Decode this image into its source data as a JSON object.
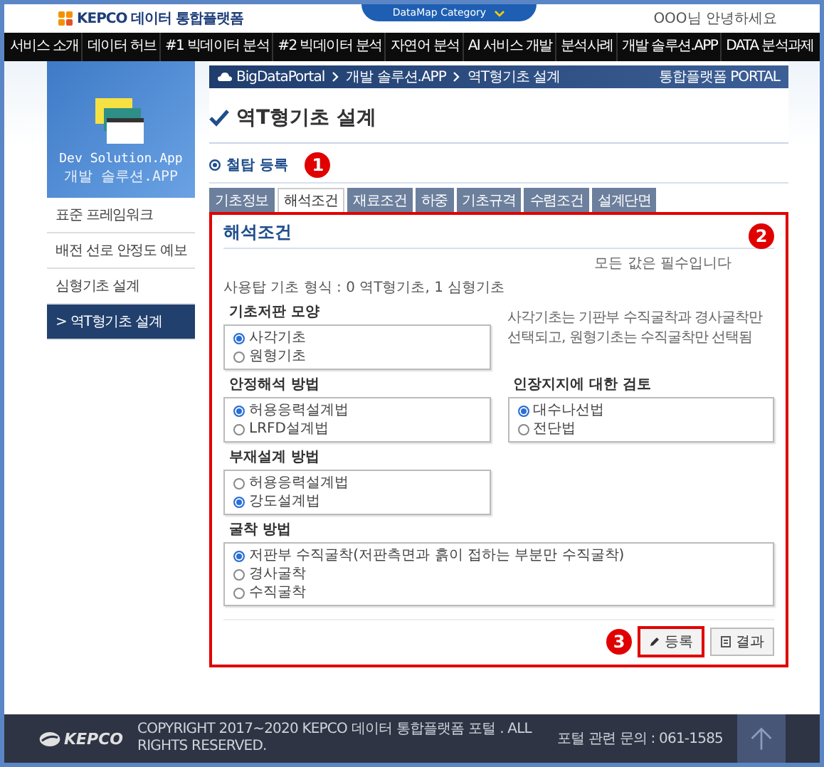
{
  "header": {
    "logo_text": "KEPCO 데이터 통합플랫폼",
    "category_tab": "DataMap Category",
    "greeting": "OOO님 안녕하세요"
  },
  "nav": [
    "서비스 소개",
    "데이터 허브",
    "#1 빅데이터 분석",
    "#2 빅데이터 분석",
    "자연어 분석",
    "AI 서비스 개발",
    "분석사례",
    "개발 솔루션.APP",
    "DATA 분석과제"
  ],
  "sidebar": {
    "banner_title": "Dev Solution.App",
    "banner_subtitle": "개발 솔루션.APP",
    "items": [
      {
        "label": "표준 프레임워크",
        "selected": false
      },
      {
        "label": "배전 선로 안정도 예보",
        "selected": false
      },
      {
        "label": "심형기초 설계",
        "selected": false
      },
      {
        "label": "> 역T형기초 설계",
        "selected": true
      }
    ]
  },
  "breadcrumb": {
    "items": [
      "BigDataPortal",
      "개발 솔루션.APP",
      "역T형기초 설계"
    ],
    "portal_label": "통합플랫폼 PORTAL"
  },
  "page_title": "역T형기초 설계",
  "section": {
    "title": "철탑 등록",
    "callout": "1"
  },
  "tabs": [
    {
      "label": "기초정보",
      "selected": false
    },
    {
      "label": "해석조건",
      "selected": true
    },
    {
      "label": "재료조건",
      "selected": false
    },
    {
      "label": "하중",
      "selected": false
    },
    {
      "label": "기초규격",
      "selected": false
    },
    {
      "label": "수렴조건",
      "selected": false
    },
    {
      "label": "설계단면",
      "selected": false
    }
  ],
  "panel": {
    "title": "해석조건",
    "highlighted": true,
    "callout": "2",
    "required_note": "모든 값은 필수입니다",
    "note": "사용탑 기초 형식 : 0 역T형기초, 1 심형기초",
    "rows": [
      {
        "kind": "split",
        "items": [
          {
            "kind": "group",
            "title": "기초저판 모양",
            "options": [
              {
                "label": "사각기초",
                "selected": true
              },
              {
                "label": "원형기초",
                "selected": false
              }
            ]
          },
          {
            "kind": "hint",
            "text": "사각기초는 기판부 수직굴착과 경사굴착만 선택되고, 원형기초는 수직굴착만 선택됨"
          }
        ]
      },
      {
        "kind": "split",
        "items": [
          {
            "kind": "group",
            "title": "안정해석 방법",
            "options": [
              {
                "label": "허용응력설계법",
                "selected": true
              },
              {
                "label": "LRFD설계법",
                "selected": false
              }
            ]
          },
          {
            "kind": "group",
            "title": "인장지지에 대한 검토",
            "options": [
              {
                "label": "대수나선법",
                "selected": true
              },
              {
                "label": "전단법",
                "selected": false
              }
            ]
          }
        ]
      },
      {
        "kind": "split",
        "items": [
          {
            "kind": "group",
            "title": "부재설계 방법",
            "options": [
              {
                "label": "허용응력설계법",
                "selected": false
              },
              {
                "label": "강도설계법",
                "selected": true
              }
            ]
          }
        ]
      },
      {
        "kind": "full",
        "items": [
          {
            "kind": "group",
            "title": "굴착 방법",
            "options": [
              {
                "label": "저판부 수직굴착(저판측면과 흙이 접하는 부분만 수직굴착)",
                "selected": true
              },
              {
                "label": "경사굴착",
                "selected": false
              },
              {
                "label": "수직굴착",
                "selected": false
              }
            ]
          }
        ]
      }
    ],
    "buttons": [
      {
        "label": "등록",
        "kind": "edit",
        "highlighted": true,
        "callout": "3"
      },
      {
        "label": "결과",
        "kind": "view",
        "highlighted": false
      }
    ]
  },
  "footer": {
    "logo_text": "KEPCO",
    "copyright": "COPYRIGHT 2017~2020 KEPCO 데이터 통합플랫폼 포털 . ALL RIGHTS RESERVED.",
    "contact": "포털 관련 문의 : 061-1585"
  }
}
